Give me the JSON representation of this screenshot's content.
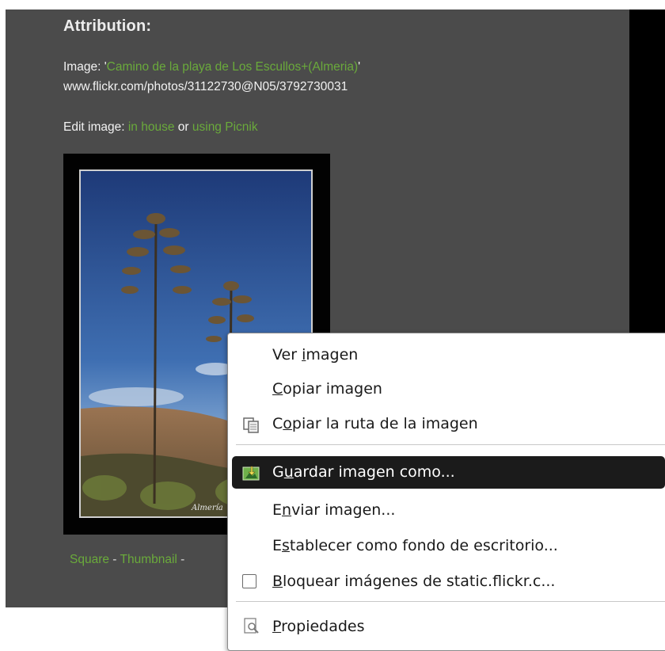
{
  "attribution": {
    "heading": "Attribution:",
    "image_prefix": "Image: '",
    "image_title": "Camino de la playa de Los Escullos+(Almeria)",
    "image_suffix": "'",
    "image_url": "www.flickr.com/photos/31122730@N05/3792730031",
    "edit_prefix": "Edit image: ",
    "edit_in_house": "in house",
    "edit_or": " or ",
    "edit_picnik": "using Picnik"
  },
  "photo": {
    "watermark": "Almería"
  },
  "size_links": {
    "square": "Square",
    "sep": " - ",
    "thumbnail": "Thumbnail",
    "trail": " -"
  },
  "context_menu": {
    "items": [
      {
        "pre": "Ver ",
        "ul": "i",
        "post": "magen",
        "icon": ""
      },
      {
        "pre": "",
        "ul": "C",
        "post": "opiar imagen",
        "icon": ""
      },
      {
        "pre": "C",
        "ul": "o",
        "post": "piar la ruta de la imagen",
        "icon": "copy-icon"
      },
      {
        "pre": "G",
        "ul": "u",
        "post": "ardar imagen como...",
        "icon": "save-image-icon",
        "highlighted": true
      },
      {
        "pre": "E",
        "ul": "n",
        "post": "viar imagen...",
        "icon": ""
      },
      {
        "pre": "E",
        "ul": "s",
        "post": "tablecer como fondo de escritorio...",
        "icon": ""
      },
      {
        "pre": "",
        "ul": "B",
        "post": "loquear imágenes de static.flickr.c...",
        "icon": "checkbox-icon",
        "checked": false
      },
      {
        "pre": "",
        "ul": "P",
        "post": "ropiedades",
        "icon": "properties-icon"
      }
    ]
  },
  "colors": {
    "panel_bg": "#4b4b4b",
    "link_green": "#6aaa3b",
    "menu_highlight": "#1b1b1b"
  }
}
